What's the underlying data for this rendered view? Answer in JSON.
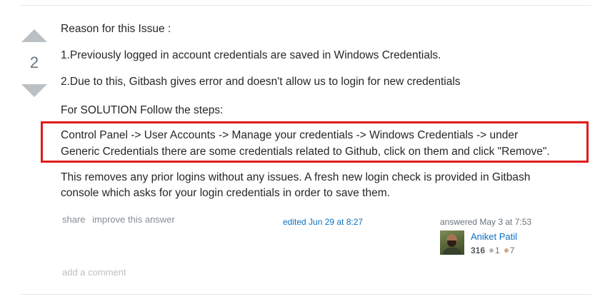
{
  "vote": {
    "count": "2"
  },
  "post": {
    "paragraphs": [
      "Reason for this Issue :",
      "1.Previously logged in account credentials are saved in Windows Credentials.",
      "2.Due to this, Gitbash gives error and doesn't allow us to login for new credentials",
      "For SOLUTION Follow the steps:"
    ],
    "highlighted_lines": [
      "Control Panel -> User Accounts -> Manage your credentials -> Windows Credentials -> under",
      "Generic Credentials there are some credentials related to Github, click on them and click \"Remove\"."
    ],
    "closing_lines": [
      "This removes any prior logins without any issues. A fresh new login check is provided in Gitbash",
      "console which asks for your login credentials in order to save them."
    ],
    "highlight_color": "#e01b1b"
  },
  "post_menu": {
    "share": "share",
    "improve": "improve this answer"
  },
  "edit_info": "edited Jun 29 at 8:27",
  "signature": {
    "answered": "answered May 3 at 7:53",
    "user_name": "Aniket Patil",
    "reputation": "316",
    "silver_badges": "1",
    "bronze_badges": "7"
  },
  "add_comment": "add a comment",
  "colors": {
    "link": "#0c70c0",
    "muted": "#848d95",
    "vote_arrow": "#bbc0c4"
  }
}
